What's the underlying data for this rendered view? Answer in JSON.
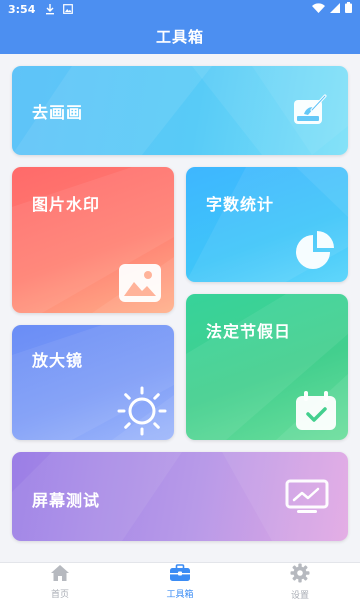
{
  "status_bar": {
    "time": "3:54",
    "icons": [
      "download-icon",
      "image-notification-icon",
      "wifi-icon",
      "signal-icon",
      "battery-icon"
    ]
  },
  "app_bar": {
    "title": "工具箱"
  },
  "tools": [
    {
      "label": "去画画",
      "icon": "paint-canvas-icon",
      "color_start": "#5fc3f8",
      "color_end": "#7be0f8"
    },
    {
      "label": "图片水印",
      "icon": "image-icon",
      "color_start": "#ff6a6a",
      "color_end": "#ffb08a"
    },
    {
      "label": "字数统计",
      "icon": "pie-chart-icon",
      "color_start": "#3eb6ff",
      "color_end": "#60d6fb"
    },
    {
      "label": "法定节假日",
      "icon": "calendar-check-icon",
      "color_start": "#37d39a",
      "color_end": "#6bde9c"
    },
    {
      "label": "放大镜",
      "icon": "sun-icon",
      "color_start": "#6a8df6",
      "color_end": "#9eb7fb"
    },
    {
      "label": "屏幕测试",
      "icon": "monitor-icon",
      "color_start": "#9b7ee6",
      "color_end": "#e2a8e4"
    }
  ],
  "bottom_nav": {
    "items": [
      {
        "label": "首页",
        "icon": "home-icon",
        "active": false
      },
      {
        "label": "工具箱",
        "icon": "toolbox-icon",
        "active": true
      },
      {
        "label": "设置",
        "icon": "gear-icon",
        "active": false
      }
    ],
    "active_color": "#3b8cf4",
    "inactive_color": "#a9adb5"
  }
}
